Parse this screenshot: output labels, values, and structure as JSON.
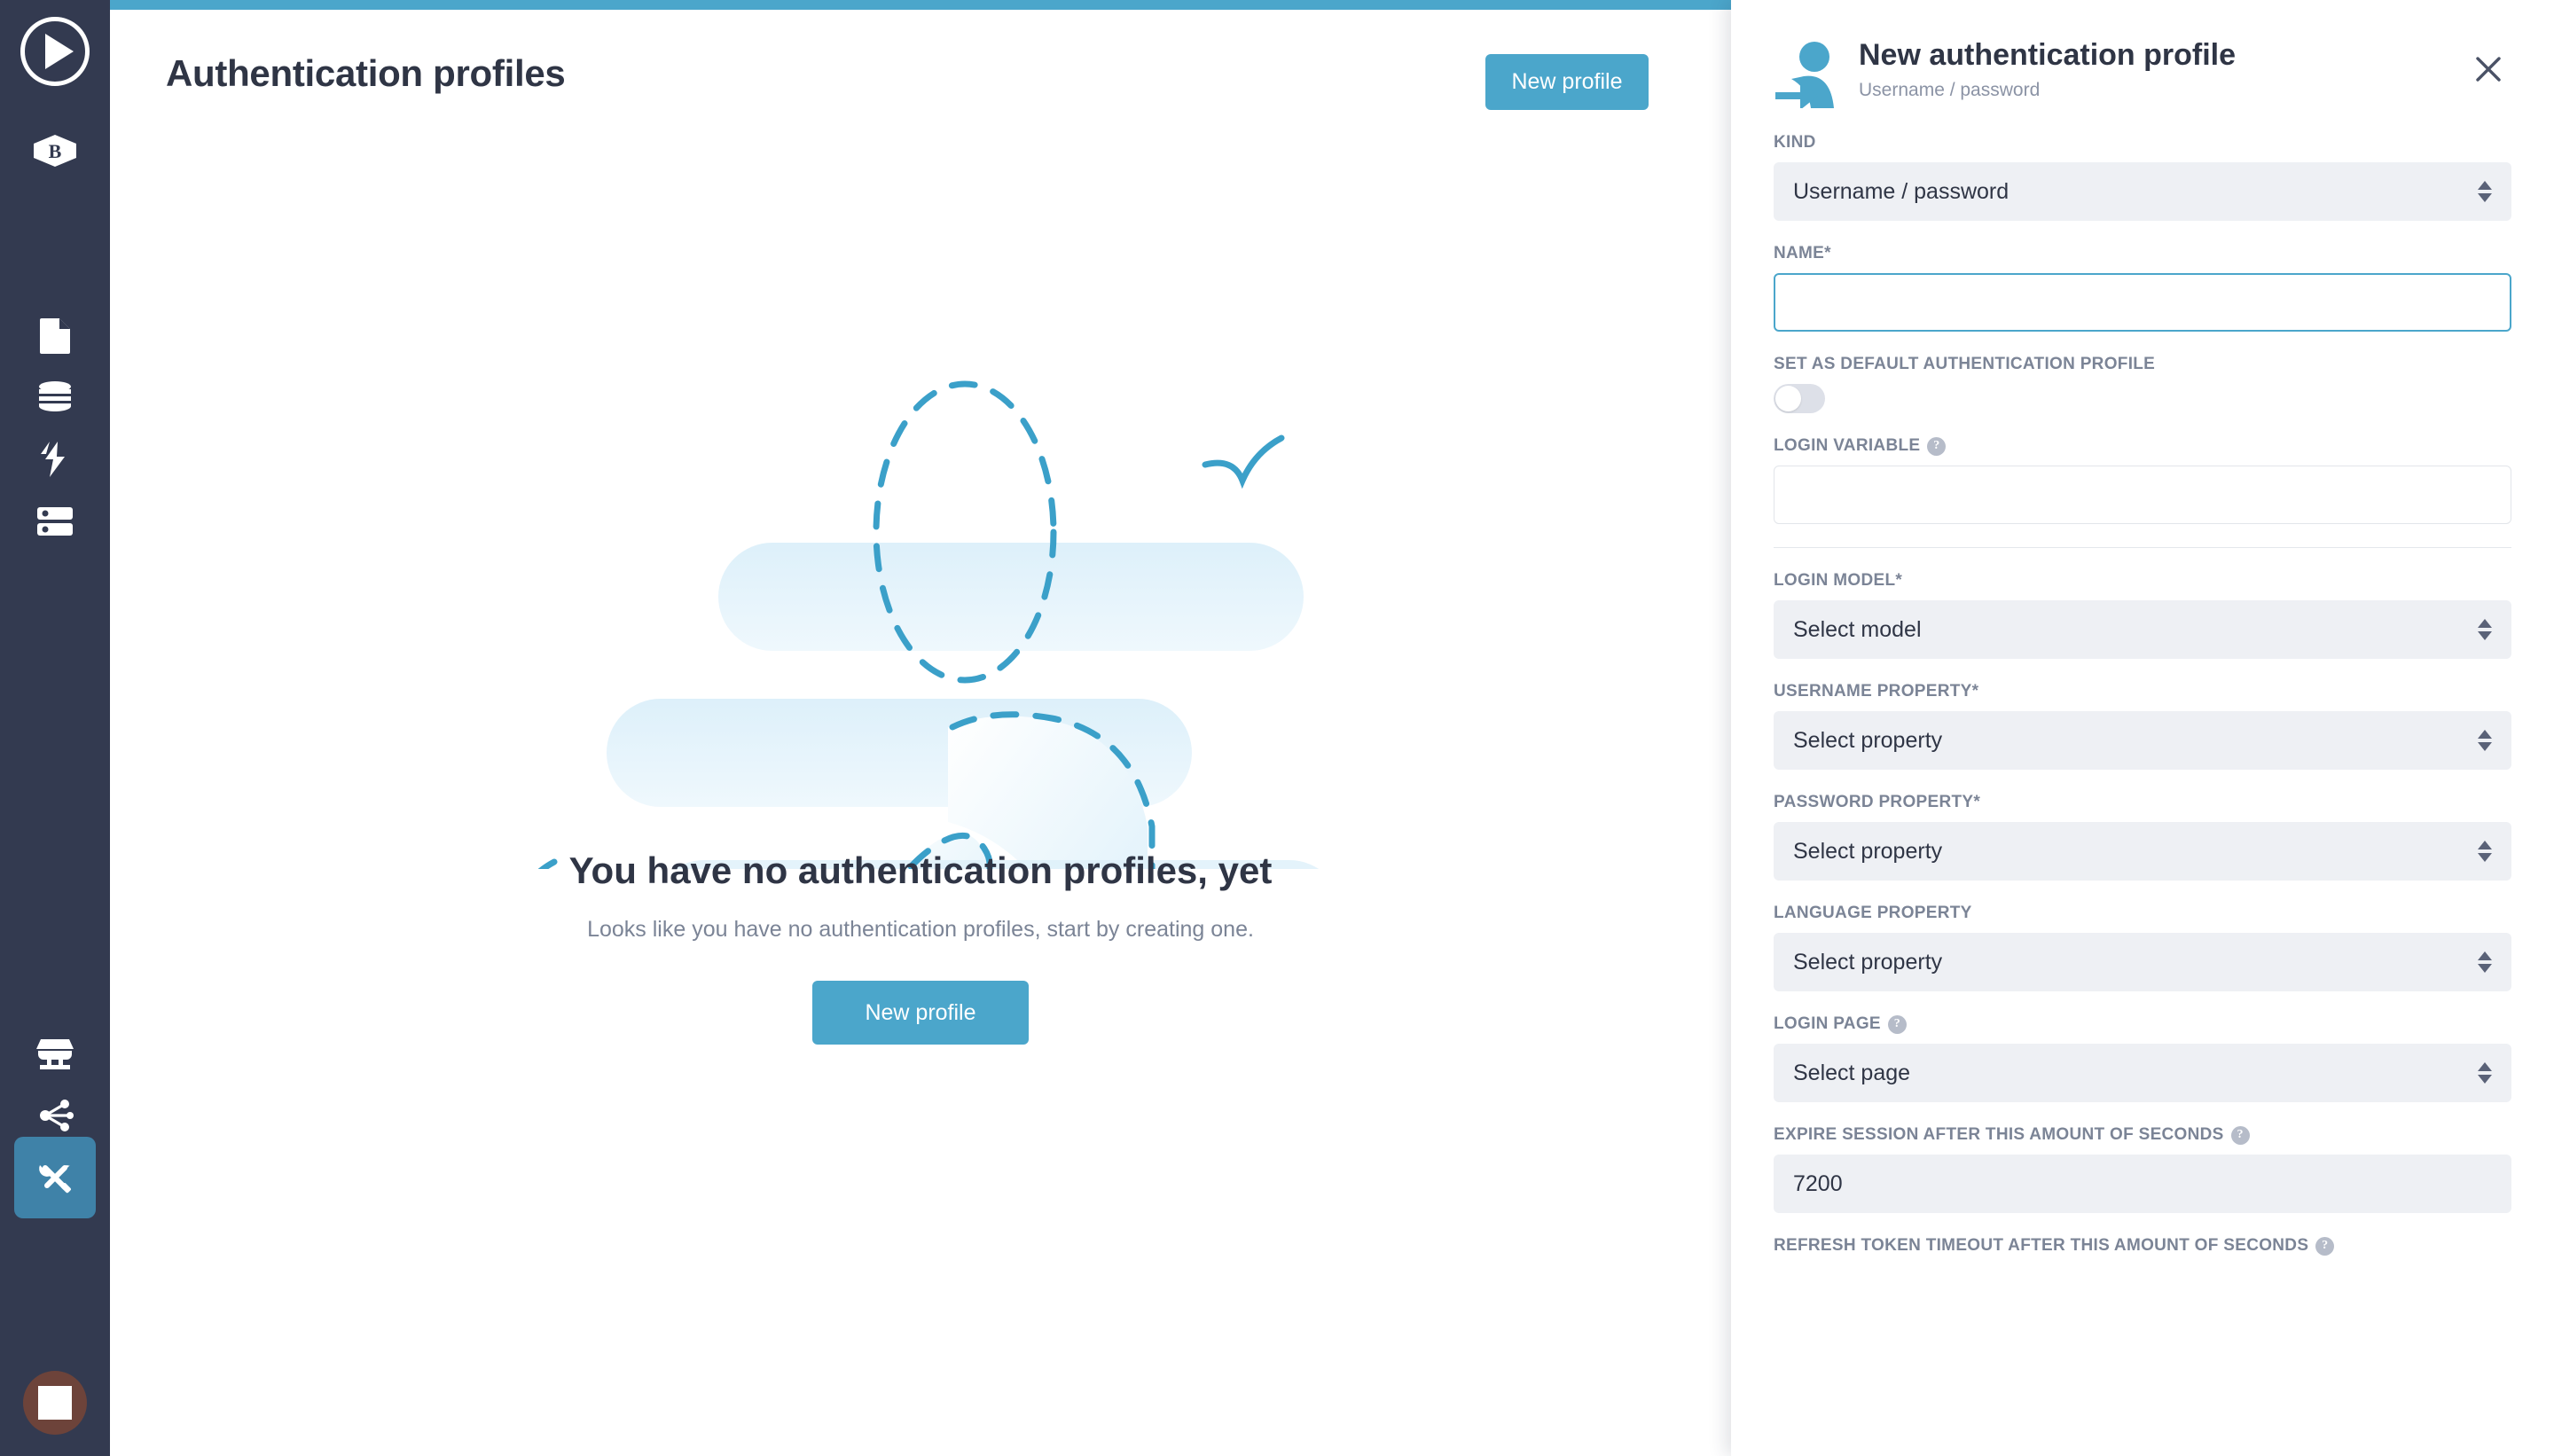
{
  "theme": {
    "accent": "#4ba6cb",
    "sidebar_bg": "#333a50",
    "sidebar_active": "#3f82a8",
    "text_dark": "#2f3545",
    "text_muted": "#7b8496",
    "input_bg": "#eef0f4",
    "avatar_bg": "#6d433a"
  },
  "sidebar": {
    "logo": {
      "icon": "play-logo-icon"
    },
    "items": [
      {
        "name": "brand-b-icon",
        "label": "B"
      },
      {
        "name": "pages-icon",
        "label": "Pages"
      },
      {
        "name": "database-icon",
        "label": "Data"
      },
      {
        "name": "actions-icon",
        "label": "Actions"
      },
      {
        "name": "servers-icon",
        "label": "Servers"
      },
      {
        "name": "marketplace-icon",
        "label": "Marketplace"
      },
      {
        "name": "integrations-icon",
        "label": "Integrations"
      },
      {
        "name": "tools-icon",
        "label": "Tools"
      }
    ],
    "avatar": {
      "name": "user-avatar",
      "label": "User"
    }
  },
  "header": {
    "title": "Authentication profiles",
    "new_profile_label": "New profile"
  },
  "empty_state": {
    "title": "You have no authentication profiles, yet",
    "subtitle": "Looks like you have no authentication profiles, start by creating one.",
    "button_label": "New profile"
  },
  "panel": {
    "icon": "login-user-icon",
    "title": "New authentication profile",
    "subtitle": "Username / password",
    "close_icon": "close-icon",
    "fields": {
      "kind": {
        "label": "KIND",
        "value": "Username / password",
        "options": [
          "Username / password"
        ]
      },
      "name": {
        "label": "NAME*",
        "value": "",
        "placeholder": ""
      },
      "set_default": {
        "label": "SET AS DEFAULT AUTHENTICATION PROFILE",
        "state": "off"
      },
      "login_variable": {
        "label": "LOGIN VARIABLE",
        "help": "?",
        "value": "",
        "placeholder": ""
      },
      "login_model": {
        "label": "LOGIN MODEL*",
        "value": "Select model"
      },
      "username_property": {
        "label": "USERNAME PROPERTY*",
        "value": "Select property"
      },
      "password_property": {
        "label": "PASSWORD PROPERTY*",
        "value": "Select property"
      },
      "language_property": {
        "label": "LANGUAGE PROPERTY",
        "value": "Select property"
      },
      "login_page": {
        "label": "LOGIN PAGE",
        "help": "?",
        "value": "Select page"
      },
      "expire_session": {
        "label": "EXPIRE SESSION AFTER THIS AMOUNT OF SECONDS",
        "help": "?",
        "value": "",
        "placeholder": "7200"
      },
      "refresh_token": {
        "label": "REFRESH TOKEN TIMEOUT AFTER THIS AMOUNT OF SECONDS",
        "help": "?"
      }
    }
  }
}
